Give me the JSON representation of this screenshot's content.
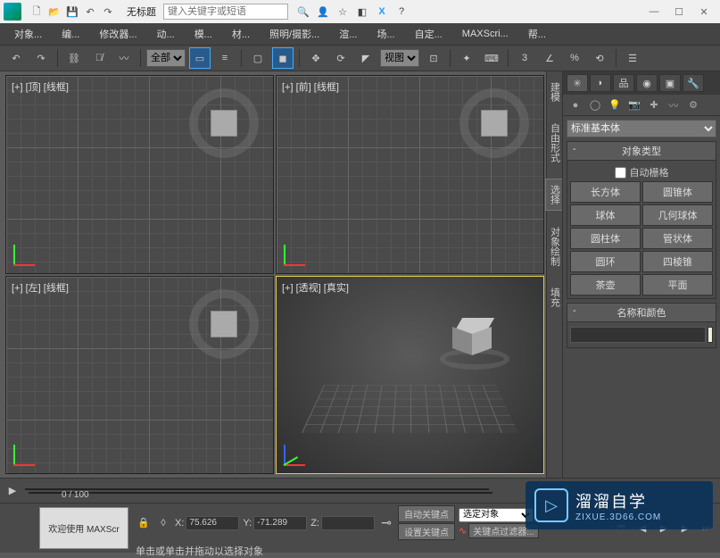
{
  "titlebar": {
    "title": "无标题",
    "search_placeholder": "键入关键字或短语"
  },
  "menu": [
    "对象...",
    "编...",
    "修改器...",
    "动...",
    "模...",
    "材...",
    "照明/摄影...",
    "渲...",
    "场...",
    "自定...",
    "MAXScri...",
    "帮..."
  ],
  "toolbar": {
    "selection_scope": "全部",
    "coord_ref": "视图",
    "angle_snap": "3"
  },
  "viewports": [
    {
      "label": "[+] [顶] [线框]"
    },
    {
      "label": "[+] [前] [线框]"
    },
    {
      "label": "[+] [左] [线框]"
    },
    {
      "label": "[+] [透视] [真实]"
    }
  ],
  "sidetabs": [
    "建模",
    "自由形式",
    "选择",
    "对象绘制",
    "填充"
  ],
  "panel": {
    "category": "标准基本体",
    "rollout_object_type": "对象类型",
    "auto_grid": "自动栅格",
    "buttons": [
      "长方体",
      "圆锥体",
      "球体",
      "几何球体",
      "圆柱体",
      "管状体",
      "圆环",
      "四棱锥",
      "茶壶",
      "平面"
    ],
    "rollout_name_color": "名称和颜色",
    "name_value": ""
  },
  "timeline": {
    "position": "0 / 100"
  },
  "statusbar": {
    "welcome": "欢迎使用 MAXScr",
    "x_label": "X:",
    "x_value": "75.626",
    "y_label": "Y:",
    "y_value": "-71.289",
    "z_label": "Z:",
    "auto_key": "自动关键点",
    "set_key": "设置关键点",
    "selected": "选定对象",
    "key_filter": "关键点过滤器...",
    "hint1": "单击或单击并拖动以选择对象"
  },
  "watermark": {
    "big": "溜溜自学",
    "small": "ZIXUE.3D66.COM"
  }
}
